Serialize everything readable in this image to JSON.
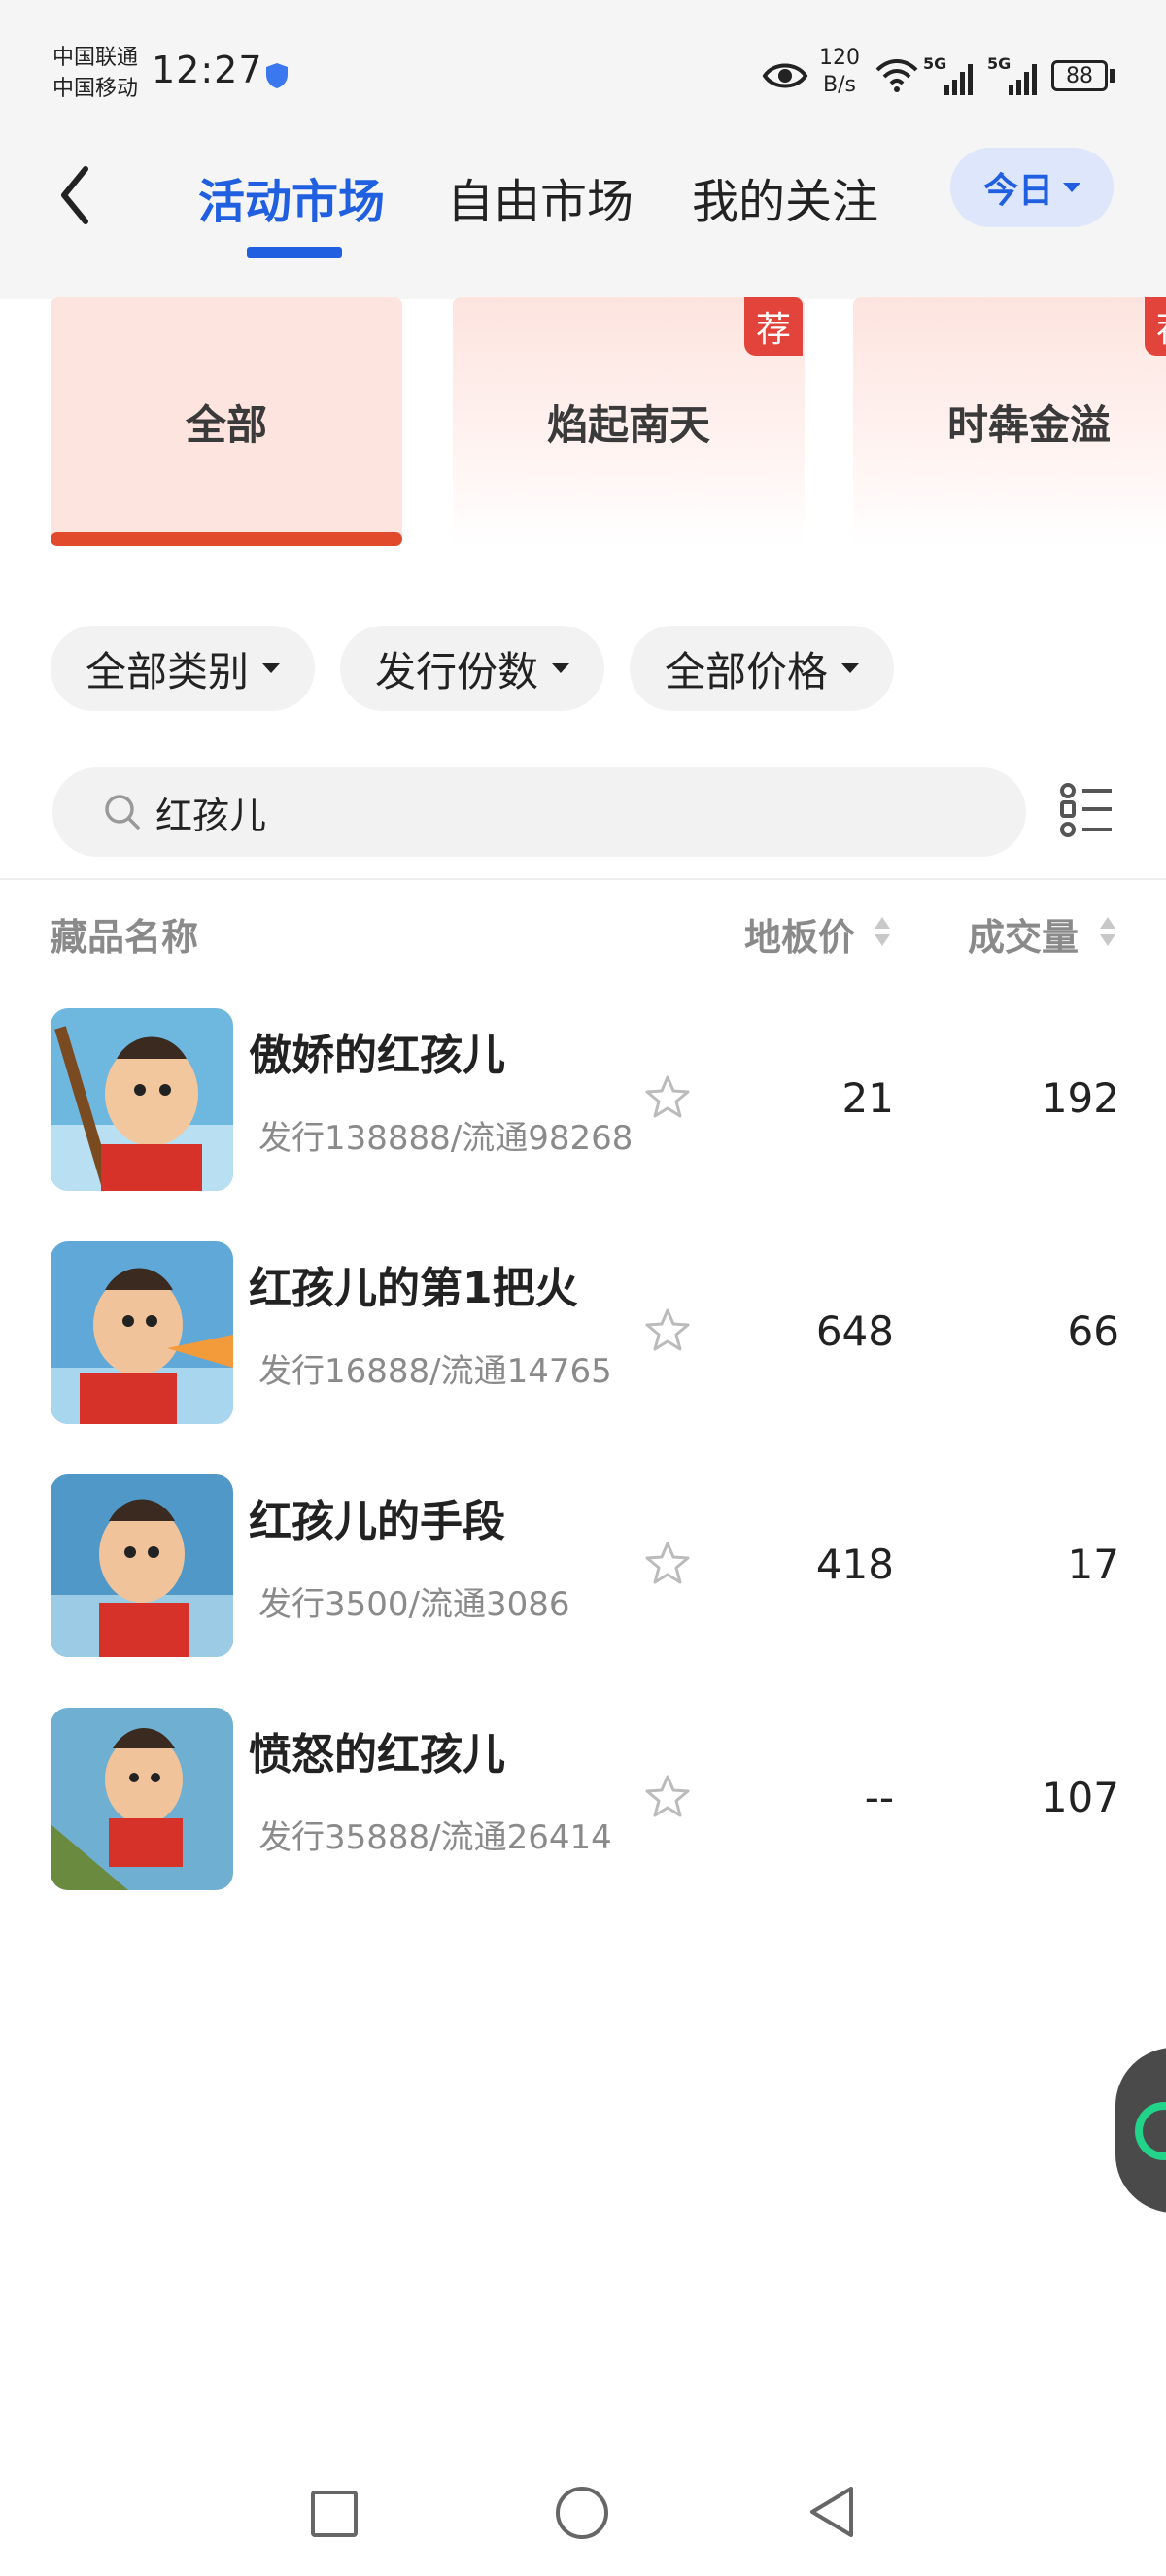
{
  "status_bar": {
    "carrier1": "中国联通",
    "carrier2": "中国移动",
    "time": "12:27",
    "net_speed_value": "120",
    "net_speed_unit": "B/s",
    "sim1_label": "5G",
    "sim2_label": "5G",
    "battery": "88"
  },
  "header": {
    "tabs": [
      {
        "label": "活动市场",
        "active": true
      },
      {
        "label": "自由市场",
        "active": false
      },
      {
        "label": "我的关注",
        "active": false
      }
    ],
    "period_label": "今日"
  },
  "categories": [
    {
      "label": "全部",
      "selected": true,
      "recommended": false
    },
    {
      "label": "焰起南天",
      "selected": false,
      "recommended": true
    },
    {
      "label": "时犇金溢",
      "selected": false,
      "recommended": true
    }
  ],
  "recommend_badge": "荐",
  "filters": [
    {
      "label": "全部类别"
    },
    {
      "label": "发行份数"
    },
    {
      "label": "全部价格"
    }
  ],
  "search": {
    "value": "红孩儿",
    "placeholder": ""
  },
  "table_header": {
    "name": "藏品名称",
    "floor_price": "地板价",
    "volume": "成交量"
  },
  "items": [
    {
      "name": "傲娇的红孩儿",
      "info": "发行138888/流通98268",
      "floor_price": "21",
      "volume": "192"
    },
    {
      "name": "红孩儿的第1把火",
      "info": "发行16888/流通14765",
      "floor_price": "648",
      "volume": "66"
    },
    {
      "name": "红孩儿的手段",
      "info": "发行3500/流通3086",
      "floor_price": "418",
      "volume": "17"
    },
    {
      "name": "愤怒的红孩儿",
      "info": "发行35888/流通26414",
      "floor_price": "--",
      "volume": "107"
    }
  ],
  "colors": {
    "accent": "#1f5fe0",
    "category_accent": "#e24a2c",
    "badge": "#e2433b"
  }
}
